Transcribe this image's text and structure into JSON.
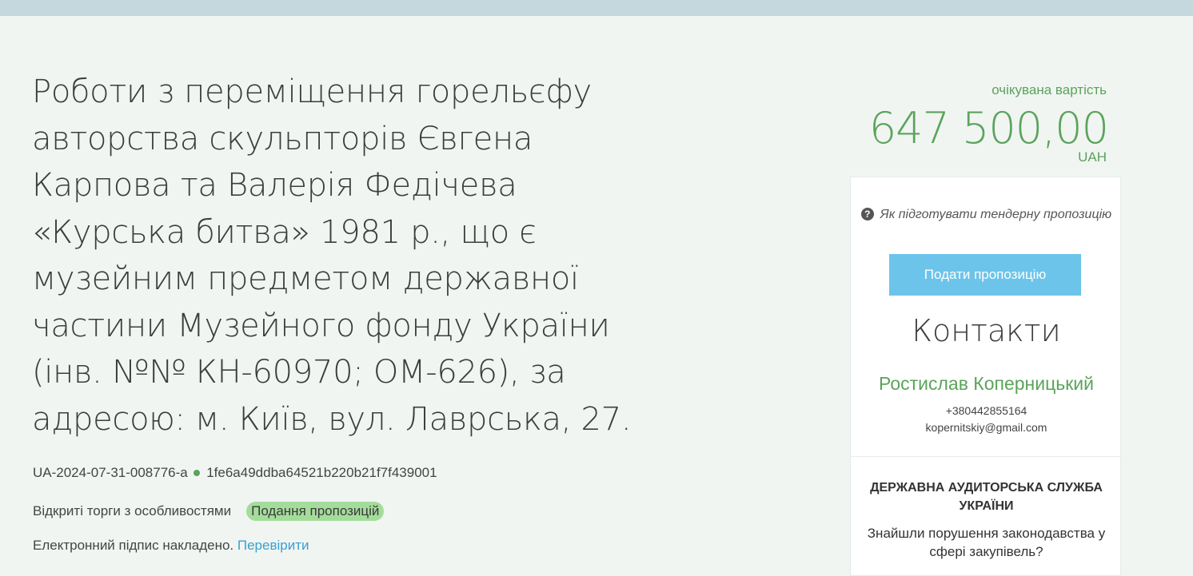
{
  "tender": {
    "title": "Роботи з переміщення горельєфу авторства скульпторів Євгена Карпова та Валерія Федічева «Курська битва» 1981 р., що є музейним предметом державної частини Музейного фонду України (інв. №№ КН-60970; ОМ-626), за адресою: м. Київ, вул. Лаврська, 27.",
    "id": "UA-2024-07-31-008776-a",
    "hash": "1fe6a49ddba64521b220b21f7f439001",
    "procedure_type": "Відкриті торги з особливостями",
    "status": "Подання пропозицій",
    "signature_text": "Електронний підпис накладено.",
    "verify_link": "Перевірити"
  },
  "value": {
    "label": "очікувана вартість",
    "amount": "647 500,00",
    "currency": "UAH"
  },
  "sidebar": {
    "howto_link": "Як підготувати тендерну пропозицію",
    "submit_button": "Подати пропозицію",
    "contacts_title": "Контакти",
    "contact_name": "Ростислав Коперницький",
    "contact_phone": "+380442855164",
    "contact_email": "kopernitskiy@gmail.com",
    "audit_title": "ДЕРЖАВНА АУДИТОРСЬКА СЛУЖБА УКРАЇНИ",
    "audit_text": "Знайшли порушення законодавства у сфері закупівель?"
  },
  "colors": {
    "accent_green": "#5ba35b",
    "badge_green": "#a4dc9b",
    "button_blue": "#6cc4ea",
    "link_blue": "#3aa0d0",
    "topbar": "#c4d8de",
    "background": "#f0f5f2"
  },
  "icons": {
    "help": "question-circle-icon",
    "status_dot": "status-dot-icon"
  }
}
